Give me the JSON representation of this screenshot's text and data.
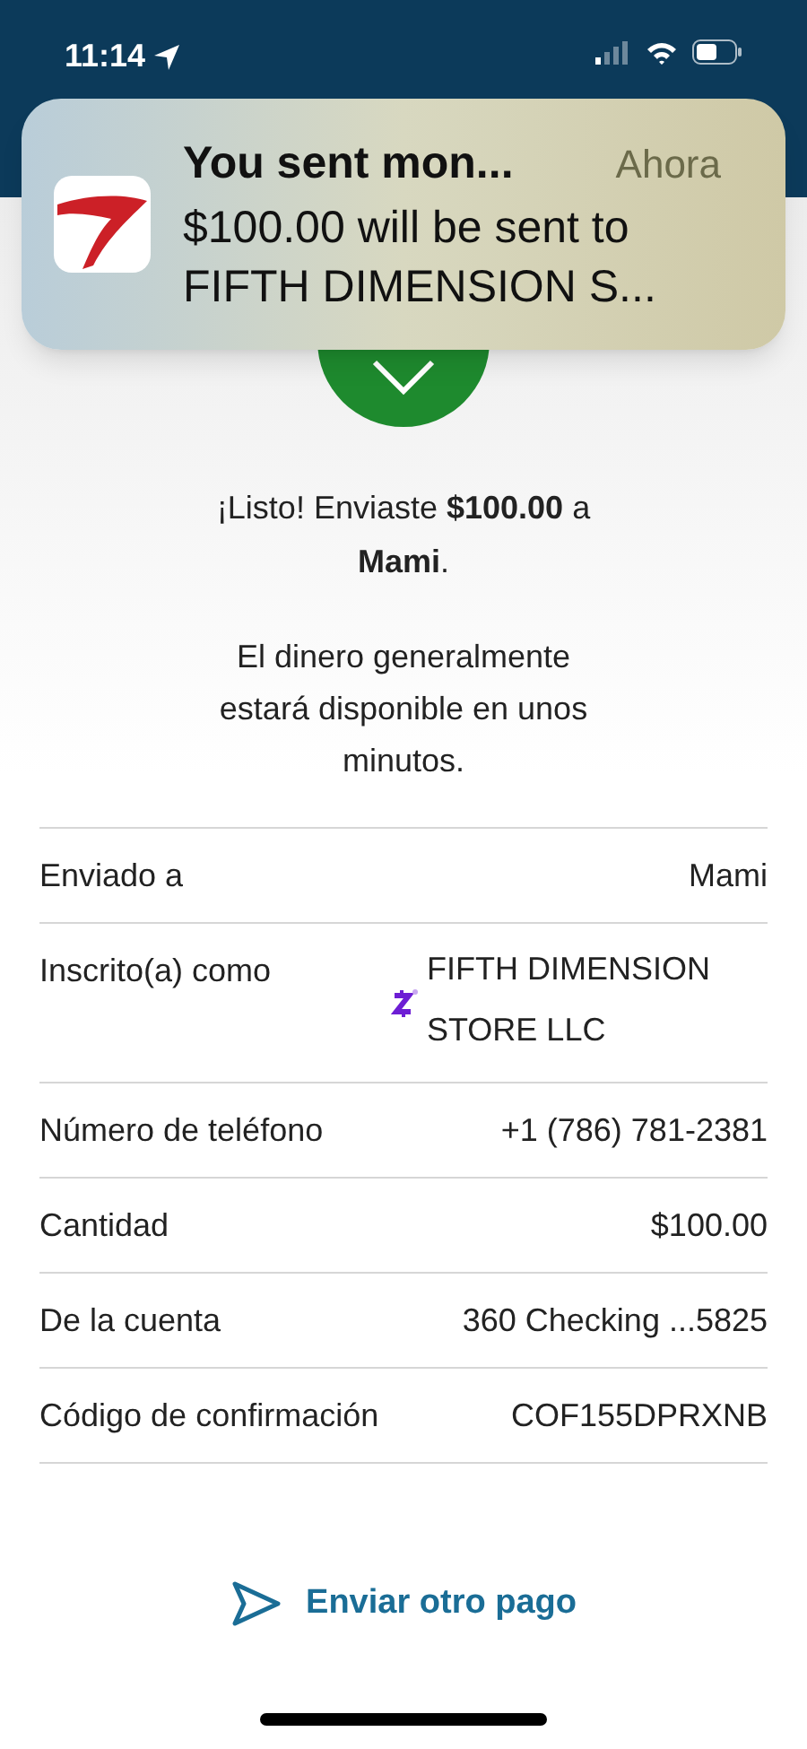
{
  "status_bar": {
    "time": "11:14"
  },
  "notification": {
    "title": "You sent mon...",
    "time": "Ahora",
    "body": "$100.00 will be sent to FIFTH DIMENSION S..."
  },
  "message": "¡Listo! Enviaste **$100.00** a **Mami**.",
  "note": "El dinero generalmente estará disponible en unos minutos.",
  "details": [
    {
      "kind": "plain",
      "label": "Enviado a",
      "value": "Mami"
    },
    {
      "kind": "zelle",
      "label": "Inscrito(a) como",
      "value": "FIFTH DIMENSION STORE LLC"
    },
    {
      "kind": "plain",
      "label": "Número de teléfono",
      "value": "+1 (786) 781-2381"
    },
    {
      "kind": "plain",
      "label": "Cantidad",
      "value": "$100.00"
    },
    {
      "kind": "plain",
      "label": "De la cuenta",
      "value": "360 Checking ...5825"
    },
    {
      "kind": "plain",
      "label": "Código de confirmación",
      "value": "COF155DPRXNB"
    }
  ],
  "action": {
    "label": "Enviar otro pago"
  }
}
